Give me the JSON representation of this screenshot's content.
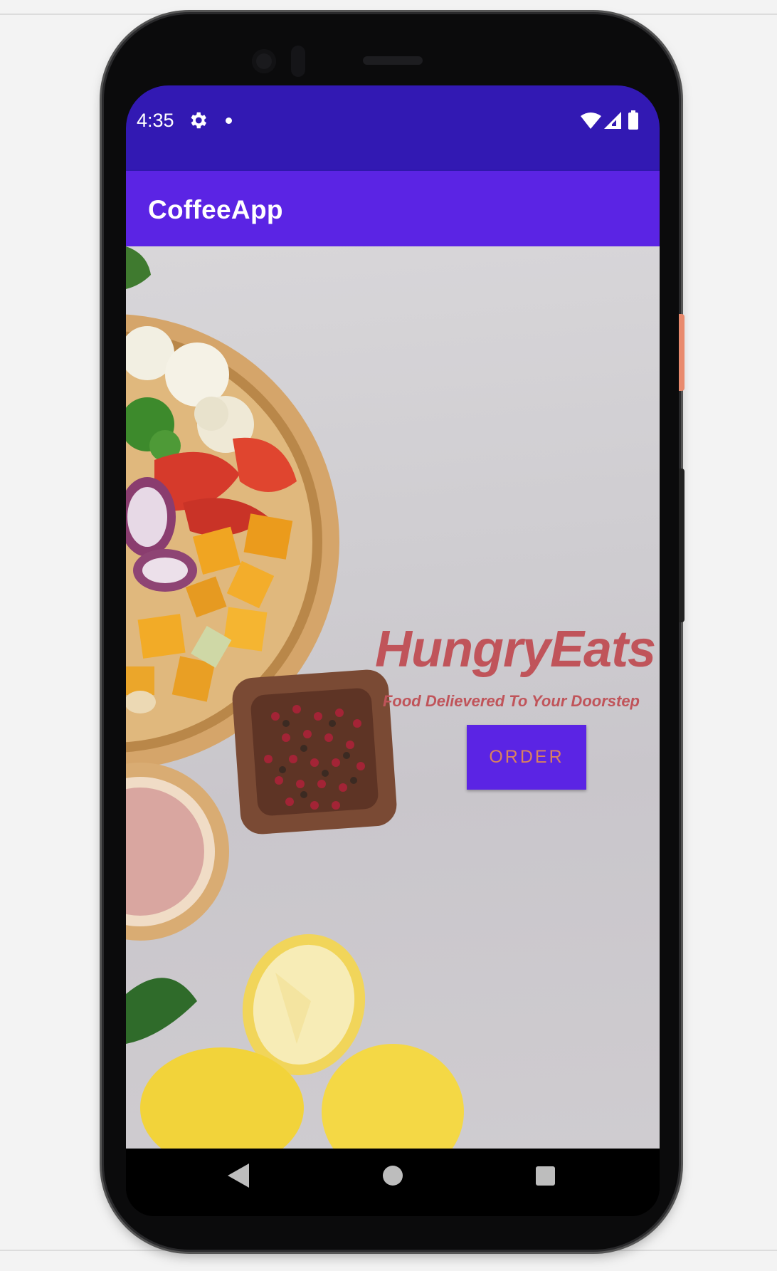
{
  "status_bar": {
    "time": "4:35",
    "icons": [
      "gear-icon",
      "notification-dot-icon",
      "wifi-icon",
      "cellular-signal-icon",
      "battery-icon"
    ],
    "background": "#3219b3"
  },
  "app_bar": {
    "title": "CoffeeApp",
    "background": "#5b24e4"
  },
  "main": {
    "brand_name": "HungryEats",
    "tagline": "Food Delievered To Your Doorstep",
    "order_button_label": "ORDER",
    "text_color": "#c0545a",
    "button_text_color": "#d9825e",
    "button_background": "#5b24e4"
  },
  "nav_bar": {
    "icons": [
      "back-icon",
      "home-icon",
      "recents-icon"
    ]
  }
}
